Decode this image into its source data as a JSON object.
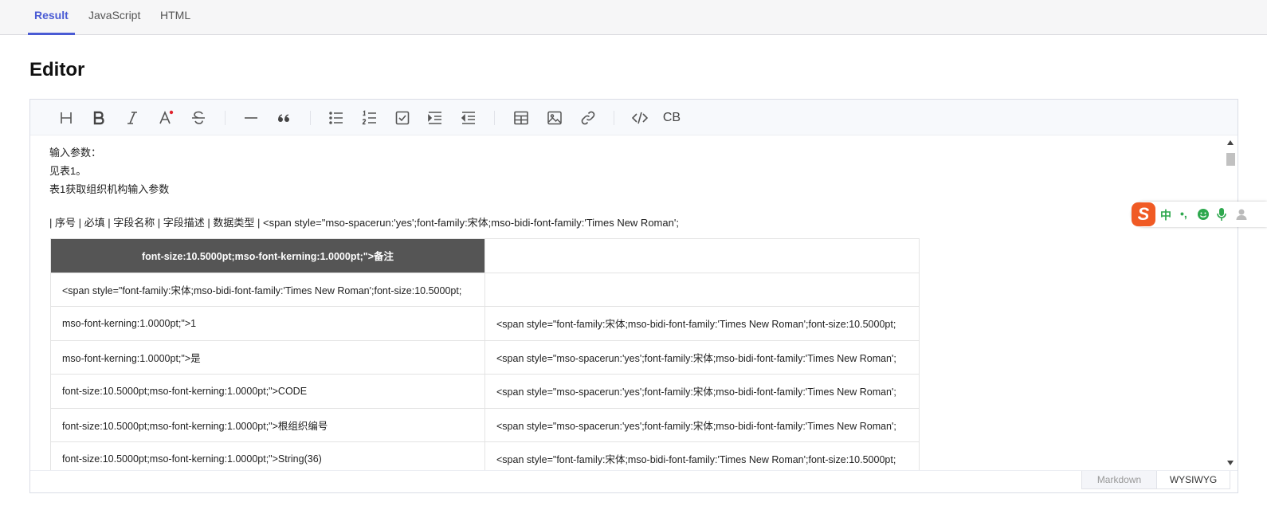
{
  "tabs": [
    {
      "label": "Result",
      "active": true
    },
    {
      "label": "JavaScript",
      "active": false
    },
    {
      "label": "HTML",
      "active": false
    }
  ],
  "page": {
    "title": "Editor"
  },
  "toolbar": {
    "buttons": [
      {
        "name": "heading-button",
        "icon": "heading-icon"
      },
      {
        "name": "bold-button",
        "icon": "bold-icon"
      },
      {
        "name": "italic-button",
        "icon": "italic-icon"
      },
      {
        "name": "text-color-button",
        "icon": "text-color-icon"
      },
      {
        "name": "strike-button",
        "icon": "strikethrough-icon"
      },
      {
        "name": "hr-button",
        "icon": "horizontal-rule-icon"
      },
      {
        "name": "quote-button",
        "icon": "quote-icon"
      },
      {
        "name": "bullet-list-button",
        "icon": "bullet-list-icon"
      },
      {
        "name": "ordered-list-button",
        "icon": "ordered-list-icon"
      },
      {
        "name": "task-list-button",
        "icon": "task-list-icon"
      },
      {
        "name": "indent-button",
        "icon": "indent-icon"
      },
      {
        "name": "outdent-button",
        "icon": "outdent-icon"
      },
      {
        "name": "table-button",
        "icon": "table-icon"
      },
      {
        "name": "image-button",
        "icon": "image-icon"
      },
      {
        "name": "link-button",
        "icon": "link-icon"
      },
      {
        "name": "code-button",
        "icon": "code-icon"
      },
      {
        "name": "codeblock-button",
        "icon": "codeblock-icon",
        "text": "CB"
      }
    ],
    "accent_dot": "#e0242e"
  },
  "content": {
    "lines": [
      "输入参数：",
      "见表1。",
      "表1获取组织机构输入参数"
    ],
    "table_intro": "| 序号 | 必填 | 字段名称 | 字段描述 | 数据类型 | <span style=\"mso-spacerun:'yes';font-family:宋体;mso-bidi-font-family:'Times New Roman';",
    "table": {
      "header": [
        "font-size:10.5000pt;mso-font-kerning:1.0000pt;\">备注",
        ""
      ],
      "rows": [
        [
          "<span style=\"font-family:宋体;mso-bidi-font-family:'Times New Roman';font-size:10.5000pt;",
          ""
        ],
        [
          "mso-font-kerning:1.0000pt;\">1",
          "<span style=\"font-family:宋体;mso-bidi-font-family:'Times New Roman';font-size:10.5000pt;"
        ],
        [
          "mso-font-kerning:1.0000pt;\">是",
          "<span style=\"mso-spacerun:'yes';font-family:宋体;mso-bidi-font-family:'Times New Roman';"
        ],
        [
          "font-size:10.5000pt;mso-font-kerning:1.0000pt;\">CODE",
          "<span style=\"mso-spacerun:'yes';font-family:宋体;mso-bidi-font-family:'Times New Roman';"
        ],
        [
          "font-size:10.5000pt;mso-font-kerning:1.0000pt;\">根组织编号",
          "<span style=\"mso-spacerun:'yes';font-family:宋体;mso-bidi-font-family:'Times New Roman';"
        ],
        [
          "font-size:10.5000pt;mso-font-kerning:1.0000pt;\">String(36)",
          "<span style=\"font-family:宋体;mso-bidi-font-family:'Times New Roman';font-size:10.5000pt;"
        ]
      ]
    }
  },
  "modes": {
    "markdown": "Markdown",
    "wysiwyg": "WYSIWYG"
  },
  "ime": {
    "logo": "S",
    "lang": "中",
    "punct": "•,",
    "icons": [
      "emoji-icon",
      "microphone-icon",
      "user-icon"
    ]
  },
  "colors": {
    "accent": "#4a5bd4",
    "header_bg": "#555555",
    "ime_brand": "#f05a24",
    "ime_green": "#2ea84e"
  }
}
